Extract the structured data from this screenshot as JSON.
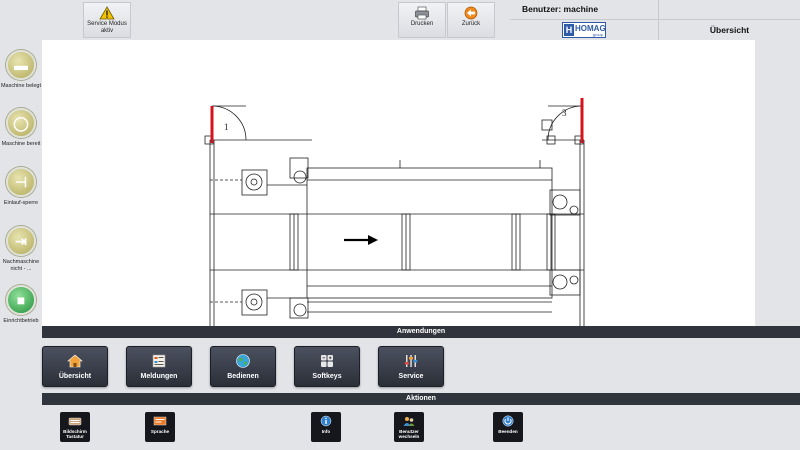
{
  "topbar": {
    "service_mode": {
      "label": "Service Modus aktiv",
      "icon": "warning-icon"
    },
    "print": {
      "label": "Drucken",
      "icon": "printer-icon"
    },
    "back": {
      "label": "Zurück",
      "icon": "back-arrow-icon"
    },
    "user": "Benutzer: machine",
    "logo": {
      "letter": "H",
      "text": "HOMAG",
      "sub": "group"
    },
    "view_title": "Übersicht"
  },
  "status": [
    {
      "label": "Maschine belegt",
      "icon": "machine-occupied-icon",
      "color": "khaki"
    },
    {
      "label": "Maschine bereit",
      "icon": "machine-ready-icon",
      "color": "khaki"
    },
    {
      "label": "Einlauf-sperre",
      "icon": "infeed-lock-icon",
      "color": "khaki"
    },
    {
      "label": "Nachmaschine nicht - ...",
      "icon": "downstream-machine-icon",
      "color": "khaki"
    },
    {
      "label": "Einrichtbetrieb",
      "icon": "setup-mode-icon",
      "color": "green"
    }
  ],
  "drawing": {
    "door_labels": [
      "1",
      "3"
    ],
    "flow_direction": "right",
    "accent_color": "#d4141c"
  },
  "sections": {
    "applications": "Anwendungen",
    "actions": "Aktionen"
  },
  "apps": [
    {
      "label": "Übersicht",
      "icon": "home-icon"
    },
    {
      "label": "Meldungen",
      "icon": "messages-icon"
    },
    {
      "label": "Bedienen",
      "icon": "operate-globe-icon"
    },
    {
      "label": "Softkeys",
      "icon": "softkeys-icon"
    },
    {
      "label": "Service",
      "icon": "service-sliders-icon"
    }
  ],
  "actions": [
    {
      "label": "Bildschirm Tastatur",
      "icon": "keyboard-icon"
    },
    {
      "label": "Sprache",
      "icon": "language-icon"
    },
    {
      "label": "Info",
      "icon": "info-icon"
    },
    {
      "label": "Benutzer wechseln",
      "icon": "switch-user-icon"
    },
    {
      "label": "Beenden",
      "icon": "power-icon"
    }
  ]
}
